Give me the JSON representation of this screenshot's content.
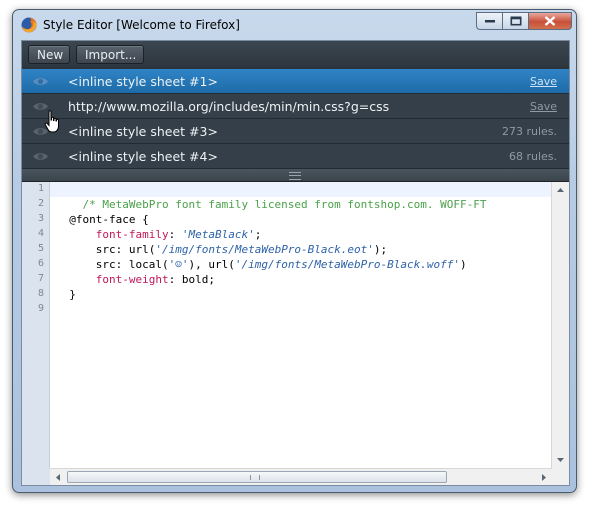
{
  "window": {
    "title": "Style Editor [Welcome to Firefox]"
  },
  "toolbar": {
    "new_label": "New",
    "import_label": "Import..."
  },
  "sheets": [
    {
      "name": "<inline style sheet #1>",
      "meta": "Save",
      "selected": true
    },
    {
      "name": "http://www.mozilla.org/includes/min/min.css?g=css",
      "meta": "Save",
      "selected": false
    },
    {
      "name": "<inline style sheet #3>",
      "meta": "273 rules.",
      "selected": false
    },
    {
      "name": "<inline style sheet #4>",
      "meta": "68 rules.",
      "selected": false
    }
  ],
  "editor": {
    "line_numbers": [
      "1",
      "2",
      "3",
      "4",
      "5",
      "6",
      "7",
      "8",
      "9"
    ],
    "comment": "/* MetaWebPro font family licensed from fontshop.com. WOFF-FT",
    "at_rule": "@font-face {",
    "prop_family": "font-family",
    "val_family": "'MetaBlack'",
    "src1_prefix": "src: url(",
    "src1_url": "'/img/fonts/MetaWebPro-Black.eot'",
    "src1_suffix": ");",
    "src2_prefix": "src: local(",
    "src2_local": "'☺'",
    "src2_mid": "), url(",
    "src2_url": "'/img/fonts/MetaWebPro-Black.woff'",
    "src2_suffix": ")",
    "prop_weight": "font-weight",
    "val_weight": ": bold;",
    "close_brace": "}"
  },
  "colors": {
    "selected_row": "#1e6ba8",
    "comment": "#4aa14a",
    "property": "#c01859",
    "string": "#2d62a8"
  }
}
